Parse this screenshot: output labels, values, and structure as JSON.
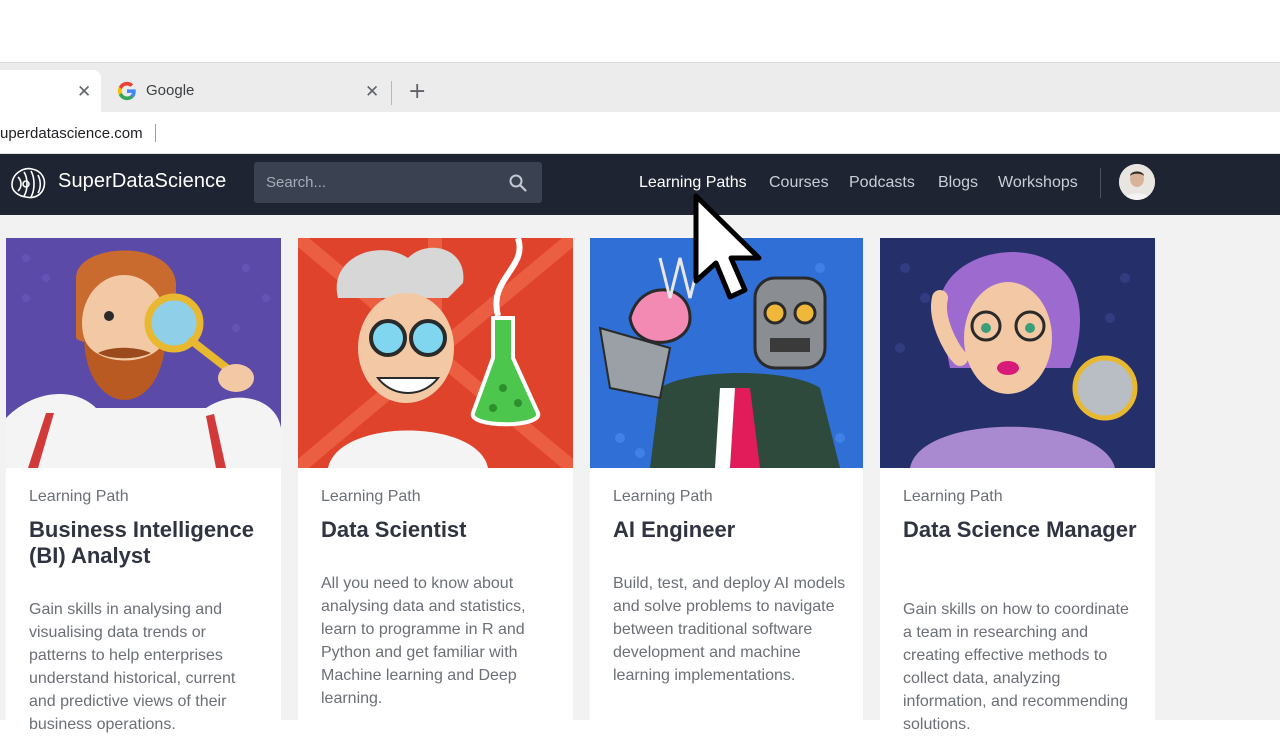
{
  "browser": {
    "tabs": [
      {
        "label": ""
      },
      {
        "label": "Google"
      }
    ],
    "url": "uperdatascience.com"
  },
  "site": {
    "brand": "SuperDataScience",
    "search": {
      "placeholder": "Search..."
    },
    "nav": [
      {
        "label": "Learning Paths",
        "active": true
      },
      {
        "label": "Courses"
      },
      {
        "label": "Podcasts"
      },
      {
        "label": "Blogs"
      },
      {
        "label": "Workshops"
      }
    ]
  },
  "cards": [
    {
      "kicker": "Learning Path",
      "title": "Business Intelligence (BI) Analyst",
      "description": "Gain skills in analysing and visualising data trends or patterns to help enterprises understand historical, current and predictive views of their business operations.",
      "image": "bearded-man-magnifying-glass-illustration"
    },
    {
      "kicker": "Learning Path",
      "title": "Data Scientist",
      "description": "All you need to know about analysing data and statistics, learn to programme in R and Python and get familiar with Machine learning and Deep learning.",
      "image": "mad-scientist-flask-illustration"
    },
    {
      "kicker": "Learning Path",
      "title": "AI Engineer",
      "description": "Build, test, and deploy AI models and solve problems to navigate between traditional software development and machine learning implementations.",
      "image": "robot-holding-brain-illustration"
    },
    {
      "kicker": "Learning Path",
      "title": "Data Science Manager",
      "description": "Gain skills on how to coordinate a team in researching and creating effective methods to collect data, analyzing information, and recommending solutions.",
      "image": "woman-with-glasses-illustration"
    }
  ],
  "colors": {
    "nav_bg": "#1e2431",
    "search_bg": "#3a4150",
    "content_bg": "#f2f2f2"
  }
}
